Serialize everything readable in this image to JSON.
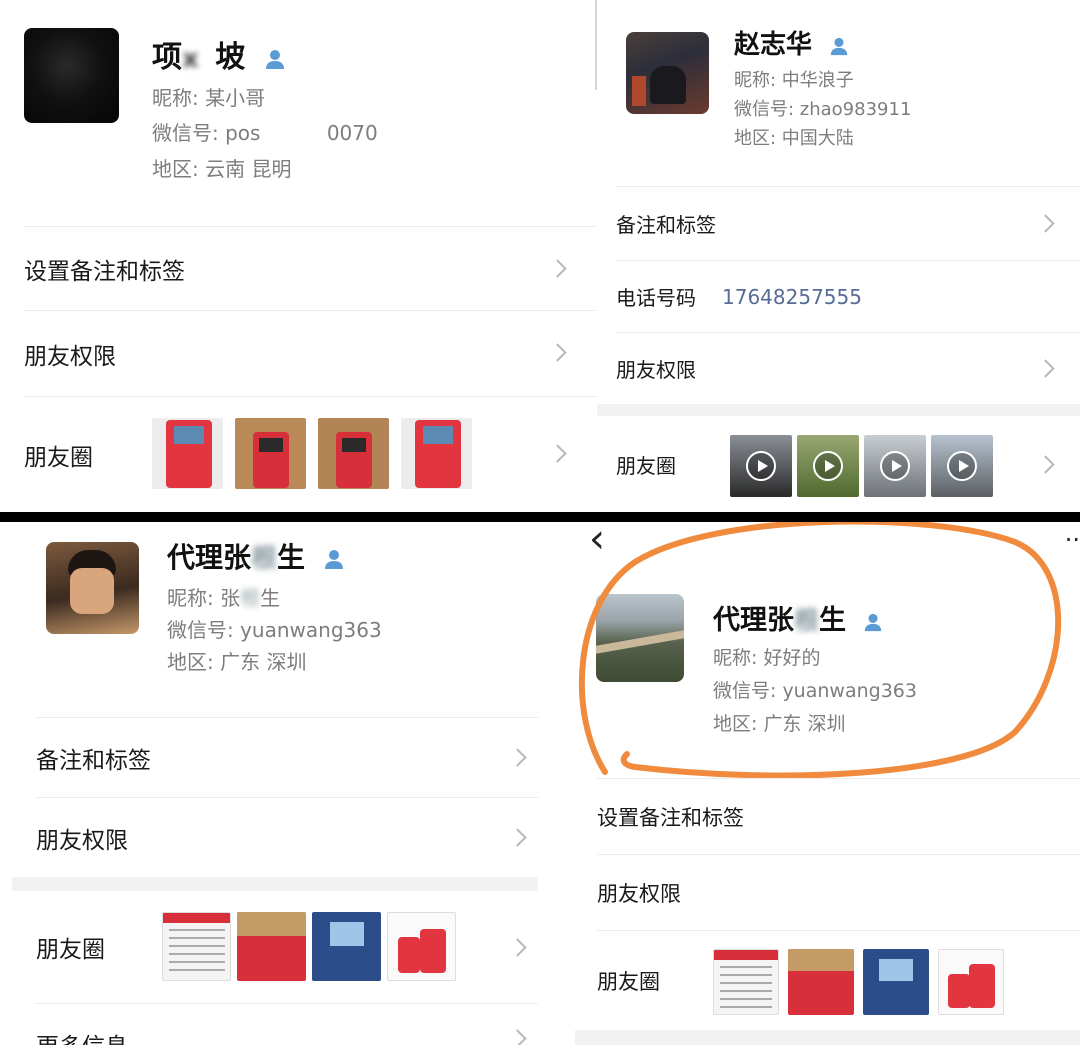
{
  "panel_tl": {
    "name_a": "项",
    "name_b": "坡",
    "nickname": "昵称:  某小哥",
    "wechat_id_prefix": "微信号:  pos",
    "wechat_id_suffix": "0070",
    "region": "地区:  云南  昆明",
    "rows": [
      "设置备注和标签",
      "朋友权限",
      "朋友圈"
    ]
  },
  "panel_tr": {
    "name": "赵志华",
    "nickname": "昵称:  中华浪子",
    "wechat_id": "微信号:  zhao983911",
    "region": "地区:  中国大陆",
    "rows": [
      "备注和标签",
      "电话号码",
      "朋友权限",
      "朋友圈"
    ],
    "phone": "17648257555"
  },
  "panel_bl": {
    "name_a": "代理张",
    "name_b": "生",
    "nickname_a": "昵称:  张",
    "nickname_b": "生",
    "wechat_id": "微信号:  yuanwang363",
    "region": "地区:  广东  深圳",
    "rows": [
      "备注和标签",
      "朋友权限",
      "朋友圈",
      "更多信息"
    ]
  },
  "panel_br": {
    "name_a": "代理张",
    "name_b": "生",
    "nickname": "昵称:  好好的",
    "wechat_id": "微信号:  yuanwang363",
    "region": "地区:  广东  深圳",
    "rows": [
      "设置备注和标签",
      "朋友权限",
      "朋友圈"
    ],
    "back": "‹",
    "more": "··"
  },
  "colors": {
    "separator": "#000000",
    "phone_link": "#576b95",
    "verified": "#5b9bd5",
    "circle": "#f08a3c"
  },
  "icons": [
    "verified-person-icon",
    "chevron-right-icon",
    "play-icon",
    "back-icon",
    "more-icon"
  ]
}
